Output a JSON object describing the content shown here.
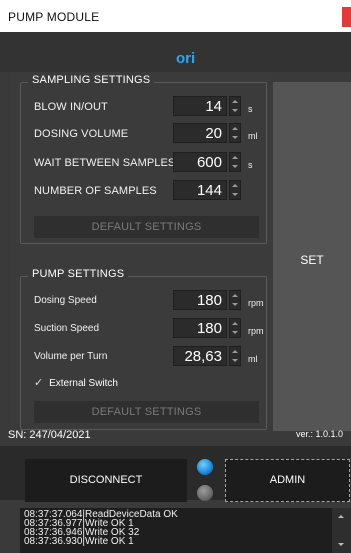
{
  "window": {
    "title": "PUMP MODULE"
  },
  "logo": {
    "text": "ori",
    "color": "#2ea6f0"
  },
  "sampling": {
    "title": "SAMPLING SETTINGS",
    "rows": [
      {
        "label": "BLOW IN/OUT",
        "value": "14",
        "unit": "s"
      },
      {
        "label": "DOSING VOLUME",
        "value": "20",
        "unit": "ml"
      },
      {
        "label": "WAIT BETWEEN SAMPLES",
        "value": "600",
        "unit": "s"
      },
      {
        "label": "NUMBER OF SAMPLES",
        "value": "144",
        "unit": ""
      }
    ],
    "default_button": "DEFAULT SETTINGS"
  },
  "set_button": "SET",
  "pump": {
    "title": "PUMP SETTINGS",
    "rows": [
      {
        "label": "Dosing Speed",
        "value": "180",
        "unit": "rpm"
      },
      {
        "label": "Suction Speed",
        "value": "180",
        "unit": "rpm"
      },
      {
        "label": "Volume per Turn",
        "value": "28,63",
        "unit": "ml"
      }
    ],
    "external_switch": {
      "label": "External Switch",
      "checked": true
    },
    "default_button": "DEFAULT SETTINGS"
  },
  "status": {
    "sn": "SN: 247/04/2021",
    "version": "ver.: 1.0.1.0"
  },
  "buttons": {
    "disconnect": "DISCONNECT",
    "admin": "ADMIN"
  },
  "indicators": {
    "on_color": "#1e86d8",
    "off_color": "#6a6a6a"
  },
  "log": [
    "08:37:37.064|ReadDeviceData OK",
    "08:37:36.977|Write OK 1",
    "08:37:36.946|Write OK 32",
    "08:37:36.930|Write OK 1"
  ]
}
